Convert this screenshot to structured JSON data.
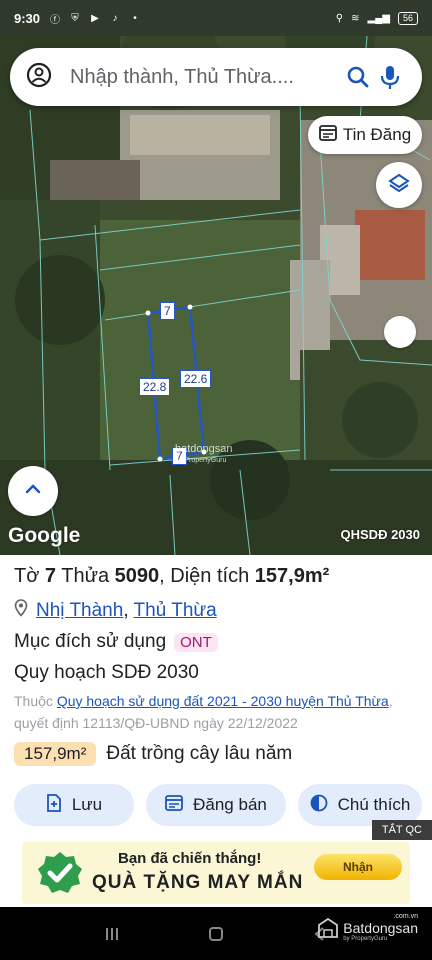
{
  "status_bar": {
    "time": "9:30",
    "battery": "56"
  },
  "search": {
    "placeholder": "Nhập thành, Thủ Thừa...."
  },
  "map": {
    "tin_dang_label": "Tin Đăng",
    "google_label": "Google",
    "overlay_label": "QHSDĐ 2030",
    "watermark": "batdongsan",
    "watermark_sub": "by PropertyGuru",
    "parcel_dims": {
      "top": "7",
      "bottom": "7",
      "left": "22.8",
      "right": "22.6"
    }
  },
  "parcel": {
    "to_label": "Tờ",
    "to_value": "7",
    "thua_label": "Thửa",
    "thua_value": "5090",
    "area_label": "Diện tích",
    "area_value": "157,9m²",
    "commune": "Nhị Thành",
    "district": "Thủ Thừa",
    "purpose_label": "Mục đích sử dụng",
    "purpose_code": "ONT",
    "plan_label": "Quy hoạch SDĐ 2030",
    "ref_prefix": "Thuộc",
    "ref_link": "Quy hoạch sử dụng đất 2021 - 2030 huyện Thủ Thừa",
    "ref_suffix": ", quyết định 12113/QĐ-UBND ngày 22/12/2022",
    "zone_area": "157,9m²",
    "zone_name": "Đất trồng cây lâu năm"
  },
  "actions": {
    "save": "Lưu",
    "sell": "Đăng bán",
    "legend": "Chú thích"
  },
  "ad": {
    "close_label": "TẮT QC",
    "line1": "Bạn đã chiến thắng!",
    "line2": "QUÀ TẶNG MAY MẮN",
    "cta": "Nhận"
  },
  "brand": {
    "name": "Batdongsan",
    "sub": "by PropertyGuru",
    "tag": ".com.vn"
  },
  "colors": {
    "link": "#1a56b8",
    "parcel_outline": "#2456c5",
    "action_bg": "#e3ecfb",
    "area_badge": "#fde0b2"
  }
}
